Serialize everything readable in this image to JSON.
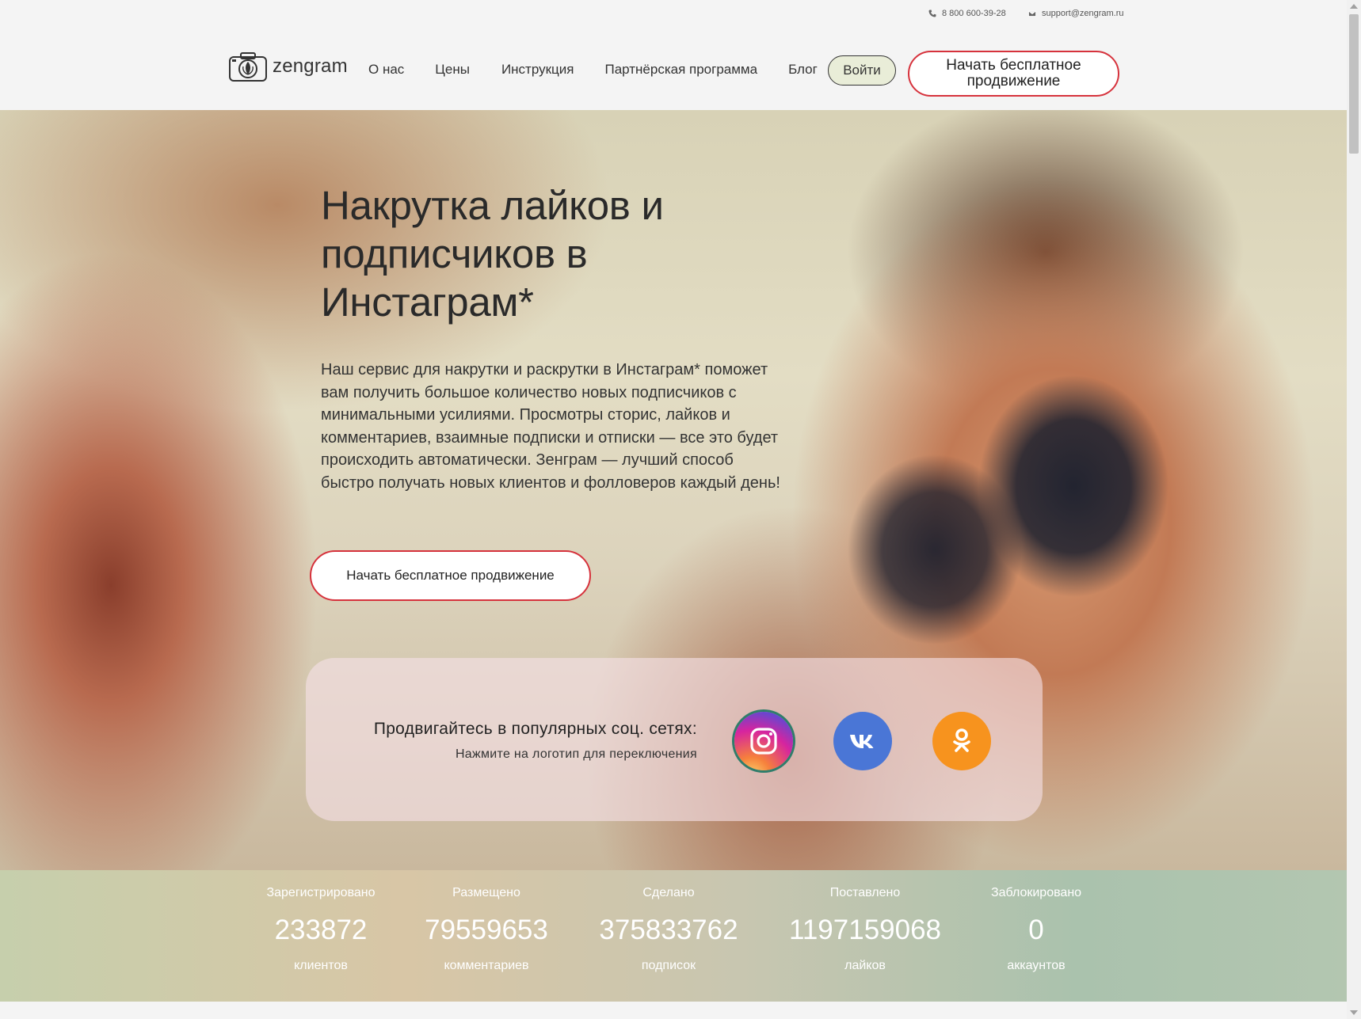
{
  "contacts": {
    "phone": "8 800 600-39-28",
    "email": "support@zengram.ru"
  },
  "brand": {
    "name": "zengram",
    "logo_icon": "camera-lotus-icon"
  },
  "nav": {
    "items": [
      {
        "label": "О нас"
      },
      {
        "label": "Цены"
      },
      {
        "label": "Инструкция"
      },
      {
        "label": "Партнёрская программа"
      },
      {
        "label": "Блог"
      }
    ],
    "login_label": "Войти",
    "start_label": "Начать бесплатное продвижение"
  },
  "hero": {
    "title": "Накрутка лайков и подписчиков в Инстаграм*",
    "description": "Наш сервис для накрутки и раскрутки в Инстаграм* поможет вам получить большое количество новых подписчиков с минимальными усилиями. Просмотры сторис, лайков и комментариев, взаимные подписки и отписки — все это будет происходить автоматически. Зенграм — лучший способ быстро получать новых клиентов и фолловеров каждый день!",
    "cta_label": "Начать бесплатное продвижение"
  },
  "social": {
    "title": "Продвигайтесь в популярных соц. сетях:",
    "hint": "Нажмите на логотип для переключения",
    "networks": [
      {
        "icon": "instagram-icon",
        "color": "#d6249f"
      },
      {
        "icon": "vk-icon",
        "color": "#4a76d6"
      },
      {
        "icon": "odnoklassniki-icon",
        "color": "#f7931e"
      }
    ]
  },
  "stats": [
    {
      "top": "Зарегистрировано",
      "value": "233872",
      "bottom": "клиентов"
    },
    {
      "top": "Размещено",
      "value": "79559653",
      "bottom": "комментариев"
    },
    {
      "top": "Сделано",
      "value": "375833762",
      "bottom": "подписок"
    },
    {
      "top": "Поставлено",
      "value": "1197159068",
      "bottom": "лайков"
    },
    {
      "top": "Заблокировано",
      "value": "0",
      "bottom": "аккаунтов"
    }
  ],
  "colors": {
    "accent_red": "#d6323c",
    "vk_blue": "#4a76d6",
    "ok_orange": "#f7931e"
  }
}
